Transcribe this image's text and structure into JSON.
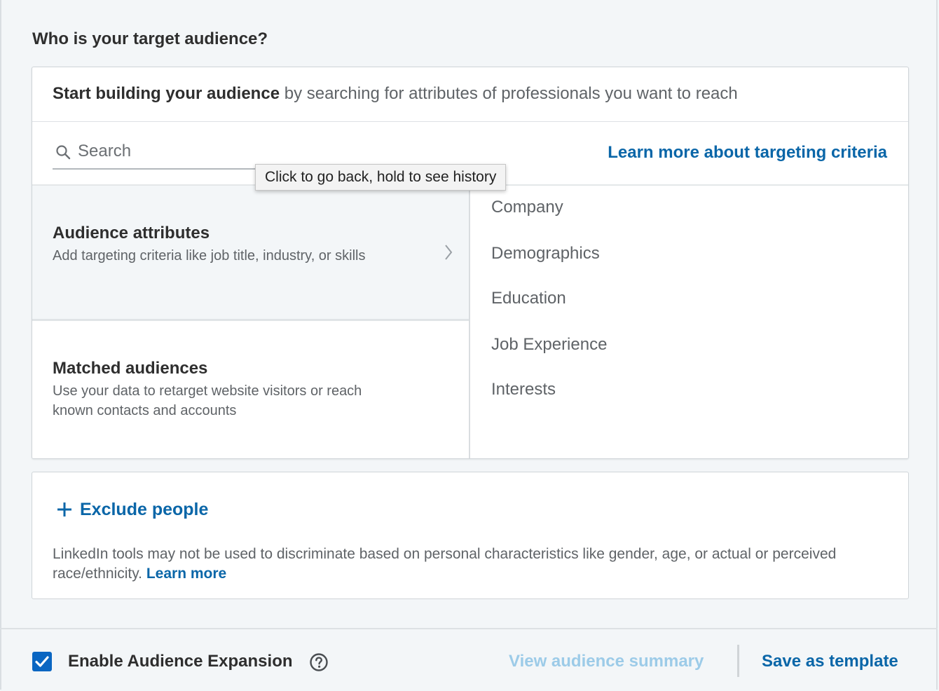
{
  "page": {
    "heading": "Who is your target audience?"
  },
  "builder": {
    "header_bold": "Start building your audience",
    "header_rest": " by searching for attributes of professionals you want to reach",
    "search_placeholder": "Search",
    "learn_more": "Learn more about targeting criteria",
    "tooltip": "Click to go back, hold to see history",
    "options": [
      {
        "title": "Audience attributes",
        "description": "Add targeting criteria like job title, industry, or skills"
      },
      {
        "title": "Matched audiences",
        "description": "Use your data to retarget website visitors or reach known contacts and accounts"
      }
    ],
    "categories": [
      "Company",
      "Demographics",
      "Education",
      "Job Experience",
      "Interests"
    ]
  },
  "exclude": {
    "button_label": "Exclude people",
    "disclaimer": "LinkedIn tools may not be used to discriminate based on personal characteristics like gender, age, or actual or perceived race/ethnicity. ",
    "learn_more": "Learn more"
  },
  "footer": {
    "expansion_label": "Enable Audience Expansion",
    "expansion_checked": true,
    "view_summary": "View audience summary",
    "save_template": "Save as template"
  },
  "colors": {
    "link": "#0a66a8",
    "link_disabled": "#9ccbe8",
    "checkbox": "#0a66c2",
    "background": "#f3f6f8"
  },
  "icons": [
    "search-icon",
    "chevron-right-icon",
    "plus-icon",
    "checkmark-icon",
    "help-icon"
  ]
}
